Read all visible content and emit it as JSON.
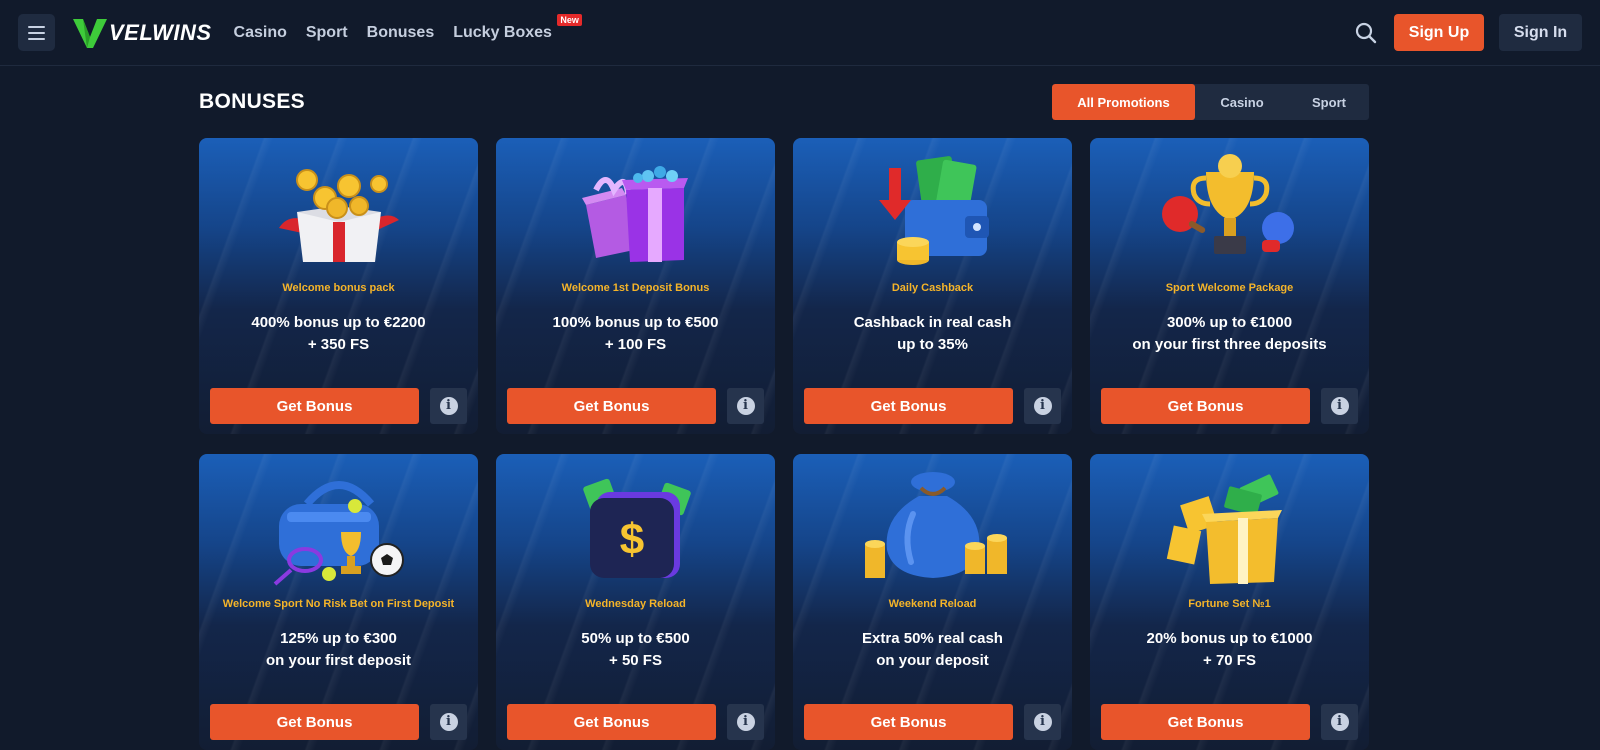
{
  "header": {
    "logo_text": "VELWINS",
    "nav": [
      {
        "label": "Casino"
      },
      {
        "label": "Sport"
      },
      {
        "label": "Bonuses"
      },
      {
        "label": "Lucky Boxes",
        "badge": "New"
      }
    ],
    "sign_up": "Sign Up",
    "sign_in": "Sign In"
  },
  "section": {
    "title": "BONUSES",
    "filters": [
      "All Promotions",
      "Casino",
      "Sport"
    ],
    "active_filter": "All Promotions"
  },
  "cards": [
    {
      "subtitle": "Welcome bonus pack",
      "line1": "400% bonus up to €2200",
      "line2": "+ 350 FS",
      "button": "Get Bonus",
      "image": "gift-box-coins"
    },
    {
      "subtitle": "Welcome 1st Deposit Bonus",
      "line1": "100% bonus up to €500",
      "line2": "+ 100 FS",
      "button": "Get Bonus",
      "image": "purple-gift-boxes"
    },
    {
      "subtitle": "Daily Cashback",
      "line1": "Cashback in real cash",
      "line2": "up to 35%",
      "button": "Get Bonus",
      "image": "wallet-cash"
    },
    {
      "subtitle": "Sport Welcome Package",
      "line1": "300% up to €1000",
      "line2": "on your first three deposits",
      "button": "Get Bonus",
      "image": "trophy-sports"
    },
    {
      "subtitle": "Welcome Sport No Risk Bet on First Deposit",
      "line1": "125% up to €300",
      "line2": "on your first deposit",
      "button": "Get Bonus",
      "image": "sports-bag"
    },
    {
      "subtitle": "Wednesday Reload",
      "line1": "50% up to €500",
      "line2": "+ 50 FS",
      "button": "Get Bonus",
      "image": "dollar-wallet"
    },
    {
      "subtitle": "Weekend Reload",
      "line1": "Extra 50% real cash",
      "line2": "on your deposit",
      "button": "Get Bonus",
      "image": "money-bag"
    },
    {
      "subtitle": "Fortune Set №1",
      "line1": "20% bonus up to €1000",
      "line2": "+ 70 FS",
      "button": "Get Bonus",
      "image": "golden-gift-cash"
    }
  ],
  "colors": {
    "accent": "#e8552b",
    "background": "#111a2b",
    "subtitle": "#f5b429",
    "logo_green": "#3ecb3a"
  }
}
